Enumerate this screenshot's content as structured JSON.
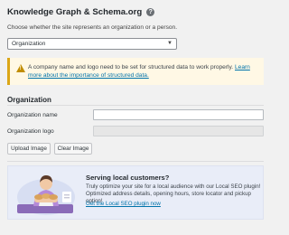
{
  "header": {
    "title": "Knowledge Graph & Schema.org",
    "help_icon": "question-circle-icon",
    "description": "Choose whether the site represents an organization or a person."
  },
  "represent_select": {
    "selected": "Organization"
  },
  "alert": {
    "icon": "warning-icon",
    "message_part1": "A company name and logo need to be set for structured data to work properly.",
    "link_text": "Learn more about the importance of structured data."
  },
  "organization": {
    "section_title": "Organization",
    "name_label": "Organization name",
    "name_value": "",
    "logo_label": "Organization logo",
    "logo_value": "",
    "upload_button": "Upload Image",
    "clear_button": "Clear Image"
  },
  "promo": {
    "title": "Serving local customers?",
    "body": "Truly optimize your site for a local audience with our Local SEO plugin! Optimized address details, opening hours, store locator and pickup option!",
    "link_text": "Get the Local SEO plugin now"
  },
  "colors": {
    "alert_border": "#dba617",
    "alert_bg": "#fff8e5",
    "link": "#0073aa",
    "promo_bg": "#e9edf8"
  }
}
